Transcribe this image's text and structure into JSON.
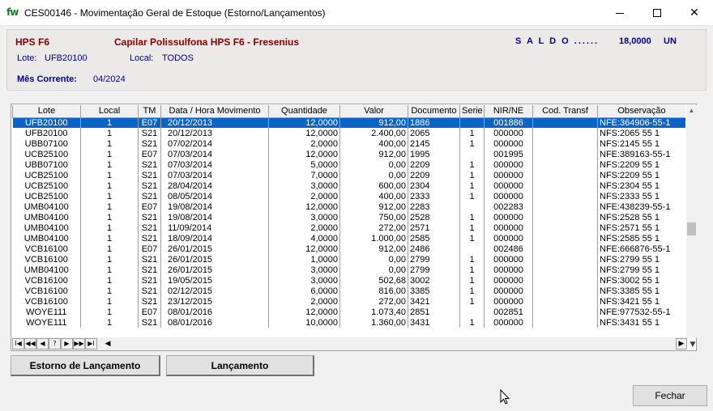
{
  "window": {
    "app_logo": "fw",
    "title": "CES00146 - Movimentação Geral de Estoque (Estorno/Lançamentos)"
  },
  "header": {
    "product_code": "HPS F6",
    "product_name": "Capilar Polissulfona HPS F6 - Fresenius",
    "saldo_label": "S A L D O ......",
    "saldo_value": "18,0000",
    "saldo_unit": "UN",
    "lote_label": "Lote:",
    "lote_value": "UFB20100",
    "local_label": "Local:",
    "local_value": "TODOS",
    "mes_label": "Mês Corrente:",
    "mes_value": "04/2024"
  },
  "grid": {
    "columns": [
      "Lote",
      "Local",
      "TM",
      "Data / Hora Movimento",
      "Quantidade",
      "Valor",
      "Documento",
      "Serie",
      "NIR/NE",
      "Cod. Transf",
      "Observação"
    ],
    "rows": [
      [
        "UFB20100",
        "1",
        "E07",
        "20/12/2013",
        "12,0000",
        "912,00",
        "1886",
        "",
        "001886",
        "",
        "NFE:364906-55-1"
      ],
      [
        "UFB20100",
        "1",
        "S21",
        "20/12/2013",
        "12,0000",
        "2.400,00",
        "2065",
        "1",
        "000000",
        "",
        "NFS:2065 55 1"
      ],
      [
        "UBB07100",
        "1",
        "S21",
        "07/02/2014",
        "2,0000",
        "400,00",
        "2145",
        "1",
        "000000",
        "",
        "NFS:2145 55 1"
      ],
      [
        "UCB25100",
        "1",
        "E07",
        "07/03/2014",
        "12,0000",
        "912,00",
        "1995",
        "",
        "001995",
        "",
        "NFE:389163-55-1"
      ],
      [
        "UBB07100",
        "1",
        "S21",
        "07/03/2014",
        "5,0000",
        "0,00",
        "2209",
        "1",
        "000000",
        "",
        "NFS:2209 55 1"
      ],
      [
        "UCB25100",
        "1",
        "S21",
        "07/03/2014",
        "7,0000",
        "0,00",
        "2209",
        "1",
        "000000",
        "",
        "NFS:2209 55 1"
      ],
      [
        "UCB25100",
        "1",
        "S21",
        "28/04/2014",
        "3,0000",
        "600,00",
        "2304",
        "1",
        "000000",
        "",
        "NFS:2304 55 1"
      ],
      [
        "UCB25100",
        "1",
        "S21",
        "08/05/2014",
        "2,0000",
        "400,00",
        "2333",
        "1",
        "000000",
        "",
        "NFS:2333 55 1"
      ],
      [
        "UMB04100",
        "1",
        "E07",
        "19/08/2014",
        "12,0000",
        "912,00",
        "2283",
        "",
        "002283",
        "",
        "NFE:438239-55-1"
      ],
      [
        "UMB04100",
        "1",
        "S21",
        "19/08/2014",
        "3,0000",
        "750,00",
        "2528",
        "1",
        "000000",
        "",
        "NFS:2528 55 1"
      ],
      [
        "UMB04100",
        "1",
        "S21",
        "11/09/2014",
        "2,0000",
        "272,00",
        "2571",
        "1",
        "000000",
        "",
        "NFS:2571 55 1"
      ],
      [
        "UMB04100",
        "1",
        "S21",
        "18/09/2014",
        "4,0000",
        "1.000,00",
        "2585",
        "1",
        "000000",
        "",
        "NFS:2585 55 1"
      ],
      [
        "VCB16100",
        "1",
        "E07",
        "26/01/2015",
        "12,0000",
        "912,00",
        "2486",
        "",
        "002486",
        "",
        "NFE:666876-55-1"
      ],
      [
        "VCB16100",
        "1",
        "S21",
        "26/01/2015",
        "1,0000",
        "0,00",
        "2799",
        "1",
        "000000",
        "",
        "NFS:2799 55 1"
      ],
      [
        "UMB04100",
        "1",
        "S21",
        "26/01/2015",
        "3,0000",
        "0,00",
        "2799",
        "1",
        "000000",
        "",
        "NFS:2799 55 1"
      ],
      [
        "VCB16100",
        "1",
        "S21",
        "19/05/2015",
        "3,0000",
        "502,68",
        "3002",
        "1",
        "000000",
        "",
        "NFS:3002 55 1"
      ],
      [
        "VCB16100",
        "1",
        "S21",
        "02/12/2015",
        "6,0000",
        "816,00",
        "3385",
        "1",
        "000000",
        "",
        "NFS:3385 55 1"
      ],
      [
        "VCB16100",
        "1",
        "S21",
        "23/12/2015",
        "2,0000",
        "272,00",
        "3421",
        "1",
        "000000",
        "",
        "NFS:3421 55 1"
      ],
      [
        "WOYE111",
        "1",
        "E07",
        "08/01/2016",
        "12,0000",
        "1.073,40",
        "2851",
        "",
        "002851",
        "",
        "NFE:977532-55-1"
      ],
      [
        "WOYE111",
        "1",
        "S21",
        "08/01/2016",
        "10,0000",
        "1.360,00",
        "3431",
        "1",
        "000000",
        "",
        "NFS:3431 55 1"
      ]
    ]
  },
  "navigator": {
    "first": "I◀",
    "prev_page": "◀◀",
    "prev": "◀",
    "search": "?",
    "next": "▶",
    "next_page": "▶▶",
    "last": "▶I"
  },
  "buttons": {
    "estorno": "Estorno de Lançamento",
    "lancamento": "Lançamento",
    "fechar": "Fechar"
  },
  "colors": {
    "selection": "#0a64c8",
    "product_text": "#8b0000",
    "info_text": "#00008b"
  }
}
